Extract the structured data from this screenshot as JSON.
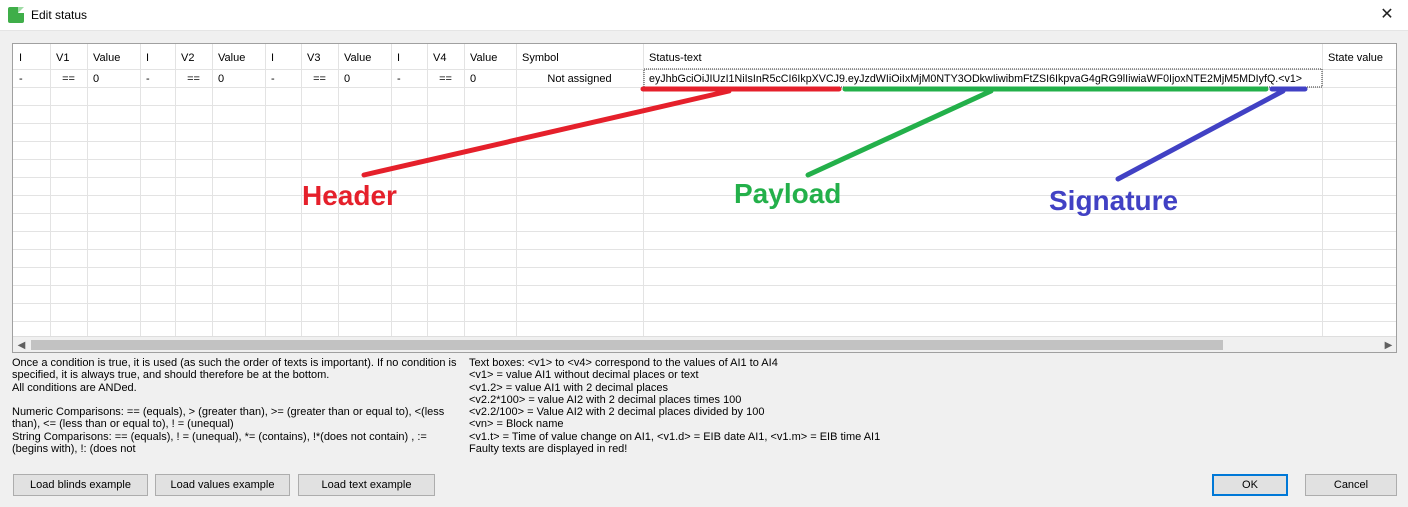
{
  "window": {
    "title": "Edit status",
    "close_glyph": "✕"
  },
  "grid": {
    "columns": [
      "I",
      "V1",
      "Value",
      "I",
      "V2",
      "Value",
      "I",
      "V3",
      "Value",
      "I",
      "V4",
      "Value",
      "Symbol",
      "Status-text",
      "State value"
    ],
    "rows": [
      [
        "-",
        "==",
        "0",
        "-",
        "==",
        "0",
        "-",
        "==",
        "0",
        "-",
        "==",
        "0",
        "Not assigned",
        "eyJhbGciOiJIUzI1NiIsInR5cCI6IkpXVCJ9.eyJzdWIiOiIxMjM0NTY3ODkwIiwibmFtZSI6IkpvaG4gRG9lIiwiaWF0IjoxNTE2MjM5MDIyfQ.<v1>",
        ""
      ]
    ]
  },
  "annotations": {
    "header": {
      "label": "Header",
      "color": "#e5202b"
    },
    "payload": {
      "label": "Payload",
      "color": "#23b04a"
    },
    "signature": {
      "label": "Signature",
      "color": "#4141c4"
    }
  },
  "help": {
    "left": "Once a condition is true, it is used (as such the order of texts is important). If no condition is specified, it is always true, and should therefore be at the bottom.\nAll conditions are ANDed.\n\nNumeric Comparisons: == (equals), > (greater than), >= (greater than or equal to), <(less than), <= (less than or equal to), ! = (unequal)\nString Comparisons: == (equals), ! = (unequal), *= (contains), !*(does not contain) , := (begins with), !: (does not",
    "right": "Text boxes: <v1> to <v4> correspond to the values of AI1 to AI4\n<v1> = value AI1 without decimal places or text\n<v1.2> = value AI1 with 2 decimal places\n<v2.2*100> = value AI2 with 2 decimal places times 100\n<v2.2/100> = Value AI2 with 2 decimal places divided by 100\n<vn> = Block name\n<v1.t> = Time of value change on AI1, <v1.d> = EIB date AI1, <v1.m> = EIB time AI1\nFaulty texts are displayed in red!"
  },
  "buttons": {
    "load_blinds": "Load blinds example",
    "load_values": "Load values example",
    "load_text": "Load text example",
    "ok": "OK",
    "cancel": "Cancel"
  }
}
